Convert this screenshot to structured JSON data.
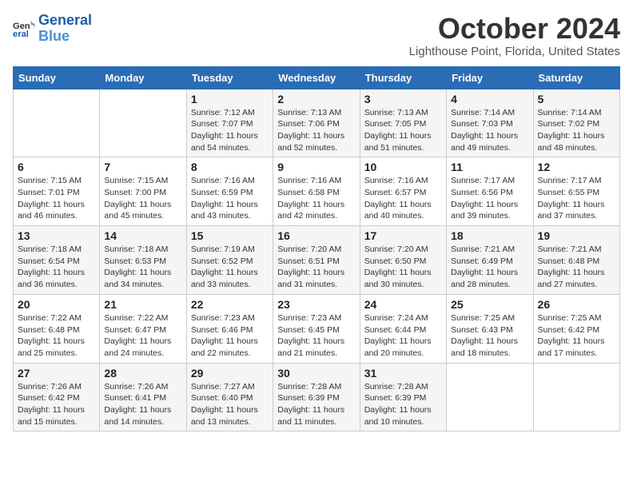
{
  "header": {
    "logo_line1": "General",
    "logo_line2": "Blue",
    "month_title": "October 2024",
    "location": "Lighthouse Point, Florida, United States"
  },
  "days_of_week": [
    "Sunday",
    "Monday",
    "Tuesday",
    "Wednesday",
    "Thursday",
    "Friday",
    "Saturday"
  ],
  "weeks": [
    [
      {
        "day": "",
        "info": ""
      },
      {
        "day": "",
        "info": ""
      },
      {
        "day": "1",
        "info": "Sunrise: 7:12 AM\nSunset: 7:07 PM\nDaylight: 11 hours and 54 minutes."
      },
      {
        "day": "2",
        "info": "Sunrise: 7:13 AM\nSunset: 7:06 PM\nDaylight: 11 hours and 52 minutes."
      },
      {
        "day": "3",
        "info": "Sunrise: 7:13 AM\nSunset: 7:05 PM\nDaylight: 11 hours and 51 minutes."
      },
      {
        "day": "4",
        "info": "Sunrise: 7:14 AM\nSunset: 7:03 PM\nDaylight: 11 hours and 49 minutes."
      },
      {
        "day": "5",
        "info": "Sunrise: 7:14 AM\nSunset: 7:02 PM\nDaylight: 11 hours and 48 minutes."
      }
    ],
    [
      {
        "day": "6",
        "info": "Sunrise: 7:15 AM\nSunset: 7:01 PM\nDaylight: 11 hours and 46 minutes."
      },
      {
        "day": "7",
        "info": "Sunrise: 7:15 AM\nSunset: 7:00 PM\nDaylight: 11 hours and 45 minutes."
      },
      {
        "day": "8",
        "info": "Sunrise: 7:16 AM\nSunset: 6:59 PM\nDaylight: 11 hours and 43 minutes."
      },
      {
        "day": "9",
        "info": "Sunrise: 7:16 AM\nSunset: 6:58 PM\nDaylight: 11 hours and 42 minutes."
      },
      {
        "day": "10",
        "info": "Sunrise: 7:16 AM\nSunset: 6:57 PM\nDaylight: 11 hours and 40 minutes."
      },
      {
        "day": "11",
        "info": "Sunrise: 7:17 AM\nSunset: 6:56 PM\nDaylight: 11 hours and 39 minutes."
      },
      {
        "day": "12",
        "info": "Sunrise: 7:17 AM\nSunset: 6:55 PM\nDaylight: 11 hours and 37 minutes."
      }
    ],
    [
      {
        "day": "13",
        "info": "Sunrise: 7:18 AM\nSunset: 6:54 PM\nDaylight: 11 hours and 36 minutes."
      },
      {
        "day": "14",
        "info": "Sunrise: 7:18 AM\nSunset: 6:53 PM\nDaylight: 11 hours and 34 minutes."
      },
      {
        "day": "15",
        "info": "Sunrise: 7:19 AM\nSunset: 6:52 PM\nDaylight: 11 hours and 33 minutes."
      },
      {
        "day": "16",
        "info": "Sunrise: 7:20 AM\nSunset: 6:51 PM\nDaylight: 11 hours and 31 minutes."
      },
      {
        "day": "17",
        "info": "Sunrise: 7:20 AM\nSunset: 6:50 PM\nDaylight: 11 hours and 30 minutes."
      },
      {
        "day": "18",
        "info": "Sunrise: 7:21 AM\nSunset: 6:49 PM\nDaylight: 11 hours and 28 minutes."
      },
      {
        "day": "19",
        "info": "Sunrise: 7:21 AM\nSunset: 6:48 PM\nDaylight: 11 hours and 27 minutes."
      }
    ],
    [
      {
        "day": "20",
        "info": "Sunrise: 7:22 AM\nSunset: 6:48 PM\nDaylight: 11 hours and 25 minutes."
      },
      {
        "day": "21",
        "info": "Sunrise: 7:22 AM\nSunset: 6:47 PM\nDaylight: 11 hours and 24 minutes."
      },
      {
        "day": "22",
        "info": "Sunrise: 7:23 AM\nSunset: 6:46 PM\nDaylight: 11 hours and 22 minutes."
      },
      {
        "day": "23",
        "info": "Sunrise: 7:23 AM\nSunset: 6:45 PM\nDaylight: 11 hours and 21 minutes."
      },
      {
        "day": "24",
        "info": "Sunrise: 7:24 AM\nSunset: 6:44 PM\nDaylight: 11 hours and 20 minutes."
      },
      {
        "day": "25",
        "info": "Sunrise: 7:25 AM\nSunset: 6:43 PM\nDaylight: 11 hours and 18 minutes."
      },
      {
        "day": "26",
        "info": "Sunrise: 7:25 AM\nSunset: 6:42 PM\nDaylight: 11 hours and 17 minutes."
      }
    ],
    [
      {
        "day": "27",
        "info": "Sunrise: 7:26 AM\nSunset: 6:42 PM\nDaylight: 11 hours and 15 minutes."
      },
      {
        "day": "28",
        "info": "Sunrise: 7:26 AM\nSunset: 6:41 PM\nDaylight: 11 hours and 14 minutes."
      },
      {
        "day": "29",
        "info": "Sunrise: 7:27 AM\nSunset: 6:40 PM\nDaylight: 11 hours and 13 minutes."
      },
      {
        "day": "30",
        "info": "Sunrise: 7:28 AM\nSunset: 6:39 PM\nDaylight: 11 hours and 11 minutes."
      },
      {
        "day": "31",
        "info": "Sunrise: 7:28 AM\nSunset: 6:39 PM\nDaylight: 11 hours and 10 minutes."
      },
      {
        "day": "",
        "info": ""
      },
      {
        "day": "",
        "info": ""
      }
    ]
  ]
}
